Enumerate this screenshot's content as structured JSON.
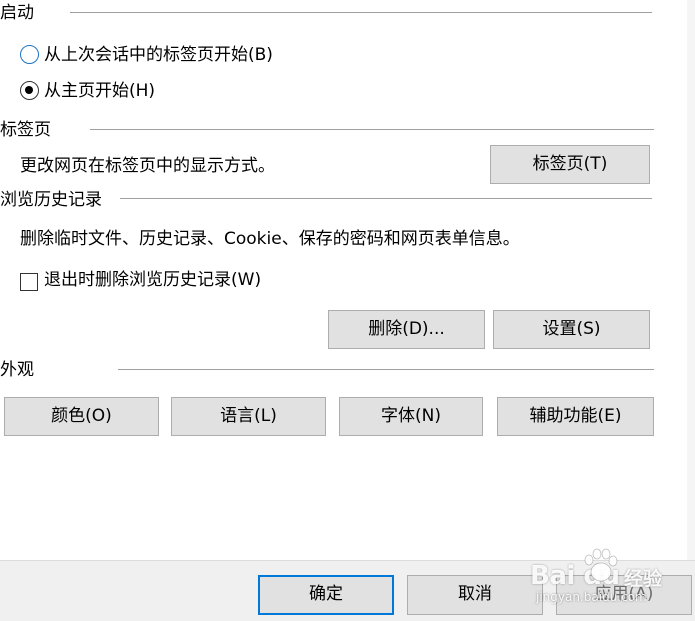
{
  "startup": {
    "title": "启动",
    "option_last_session": "从上次会话中的标签页开始(B)",
    "option_home": "从主页开始(H)"
  },
  "tabs": {
    "title": "标签页",
    "description": "更改网页在标签页中的显示方式。",
    "button": "标签页(T)"
  },
  "history": {
    "title": "浏览历史记录",
    "description": "删除临时文件、历史记录、Cookie、保存的密码和网页表单信息。",
    "checkbox_label": "退出时删除浏览历史记录(W)",
    "delete_button": "删除(D)...",
    "settings_button": "设置(S)"
  },
  "appearance": {
    "title": "外观",
    "colors_button": "颜色(O)",
    "languages_button": "语言(L)",
    "fonts_button": "字体(N)",
    "accessibility_button": "辅助功能(E)"
  },
  "footer": {
    "ok_button": "确定",
    "cancel_button": "取消",
    "apply_button": "应用(A)"
  },
  "watermark": {
    "logo": "Bai du",
    "jingyan": "经验",
    "url": "jingyan.baidu.com"
  },
  "colors": {
    "focus_border": "#0078d7",
    "button_bg": "#e1e1e1",
    "radio_unchecked": "#1e73c8"
  }
}
